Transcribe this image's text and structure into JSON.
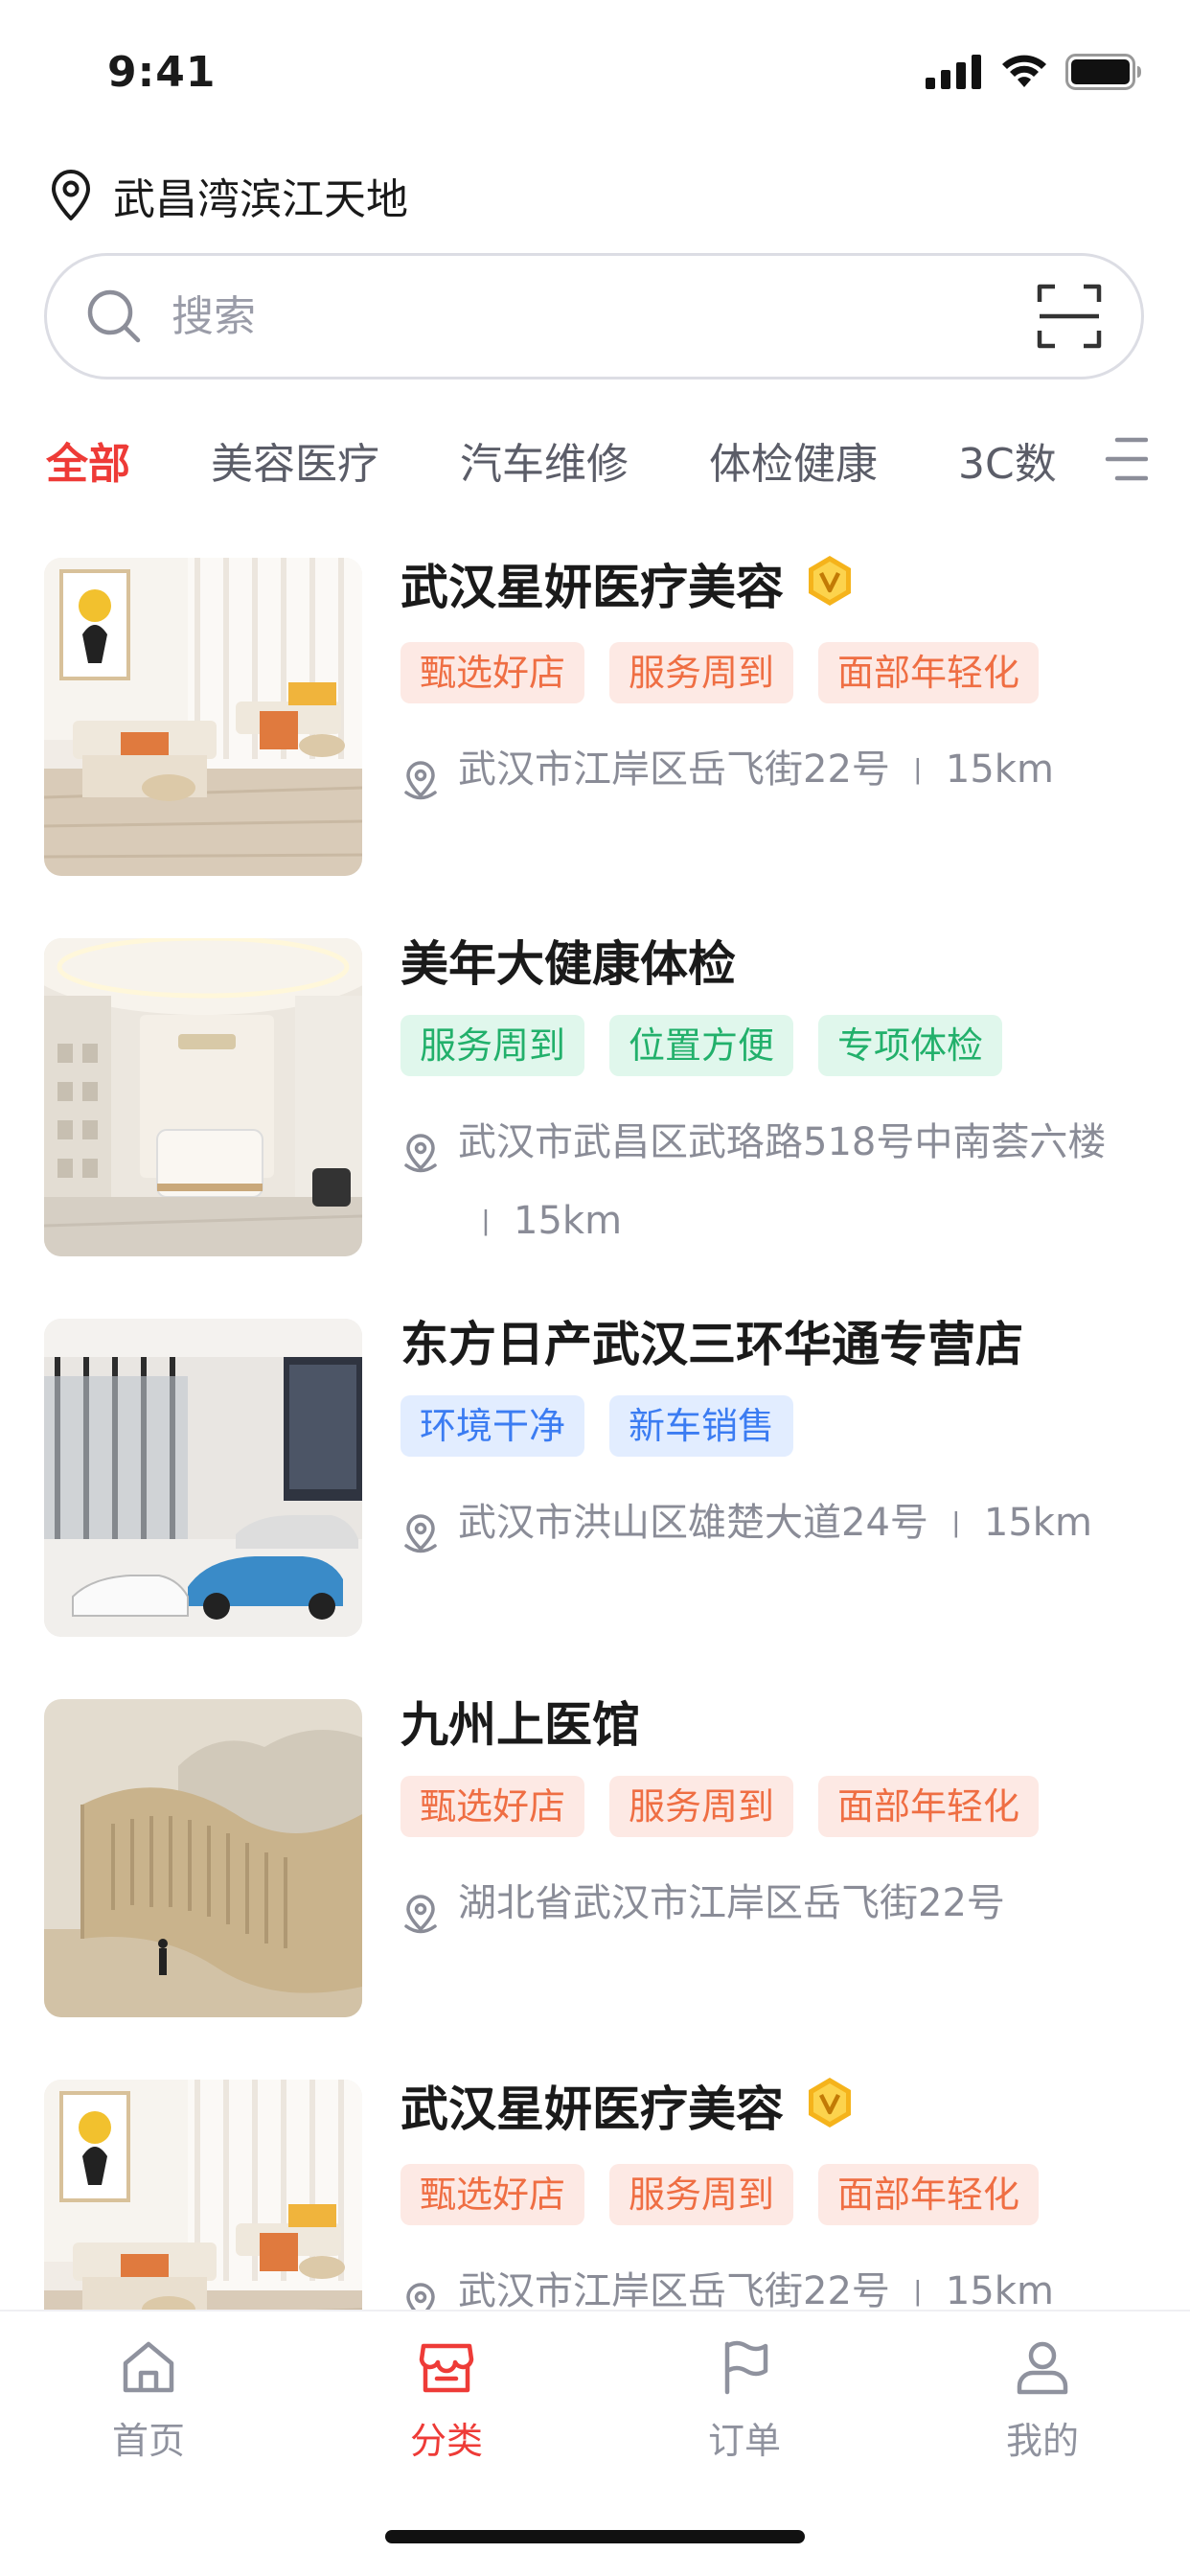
{
  "status_bar": {
    "time": "9:41"
  },
  "location": {
    "name": "武昌湾滨江天地"
  },
  "search": {
    "placeholder": "搜索"
  },
  "categories": [
    "全部",
    "美容医疗",
    "汽车维修",
    "体检健康",
    "3C数"
  ],
  "stores": [
    {
      "name": "武汉星妍医疗美容",
      "verified": true,
      "tags": [
        "甄选好店",
        "服务周到",
        "面部年轻化"
      ],
      "tag_color": "orange",
      "address": "武汉市江岸区岳飞街22号",
      "distance": "15km",
      "photo": "beauty-salon-room"
    },
    {
      "name": "美年大健康体检",
      "verified": false,
      "tags": [
        "服务周到",
        "位置方便",
        "专项体检"
      ],
      "tag_color": "green",
      "address": "武汉市武昌区武珞路518号中南荟六楼",
      "distance": "15km",
      "photo": "clinic-reception"
    },
    {
      "name": "东方日产武汉三环华通专营店",
      "verified": false,
      "tags": [
        "环境干净",
        "新车销售"
      ],
      "tag_color": "blue",
      "address": "武汉市洪山区雄楚大道24号",
      "distance": "15km",
      "photo": "car-showroom"
    },
    {
      "name": "九州上医馆",
      "verified": false,
      "tags": [
        "甄选好店",
        "服务周到",
        "面部年轻化"
      ],
      "tag_color": "orange",
      "address": "湖北省武汉市江岸区岳飞街22号",
      "distance": "",
      "photo": "calligraphy-wall"
    },
    {
      "name": "武汉星妍医疗美容",
      "verified": true,
      "tags": [
        "甄选好店",
        "服务周到",
        "面部年轻化"
      ],
      "tag_color": "orange",
      "address": "武汉市江岸区岳飞街22号",
      "distance": "15km",
      "photo": "beauty-salon-room"
    }
  ],
  "address_separator": "丨",
  "tab_bar": [
    {
      "label": "首页",
      "icon": "home-icon",
      "active": false
    },
    {
      "label": "分类",
      "icon": "store-icon",
      "active": true
    },
    {
      "label": "订单",
      "icon": "flag-icon",
      "active": false
    },
    {
      "label": "我的",
      "icon": "user-icon",
      "active": false
    }
  ],
  "colors": {
    "accent": "#ee3b37",
    "orange_tag": "#ef6e43",
    "green_tag": "#22b06b",
    "blue_tag": "#3b7cf2",
    "vip": "#f5b31b"
  }
}
